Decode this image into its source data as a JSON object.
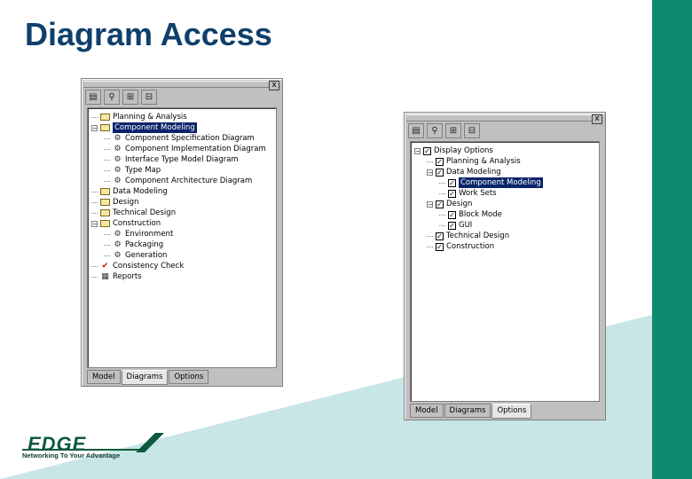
{
  "slide": {
    "title": "Diagram Access"
  },
  "logo": {
    "word": "EDGE",
    "tagline": "Networking To Your Advantage"
  },
  "left_panel": {
    "close": "x",
    "tree": [
      {
        "label": "Planning & Analysis",
        "level": 0
      },
      {
        "label": "Component Modeling",
        "level": 0,
        "selected": true
      },
      {
        "label": "Component Specification Diagram",
        "level": 1
      },
      {
        "label": "Component Implementation Diagram",
        "level": 1
      },
      {
        "label": "Interface Type Model Diagram",
        "level": 1
      },
      {
        "label": "Type Map",
        "level": 1
      },
      {
        "label": "Component Architecture Diagram",
        "level": 1
      },
      {
        "label": "Data Modeling",
        "level": 0
      },
      {
        "label": "Design",
        "level": 0
      },
      {
        "label": "Technical Design",
        "level": 0
      },
      {
        "label": "Construction",
        "level": 0
      },
      {
        "label": "Environment",
        "level": 1
      },
      {
        "label": "Packaging",
        "level": 1
      },
      {
        "label": "Generation",
        "level": 1
      },
      {
        "label": "Consistency Check",
        "level": 0
      },
      {
        "label": "Reports",
        "level": 0
      }
    ],
    "tabs": [
      "Model",
      "Diagrams",
      "Options"
    ],
    "active_tab": "Diagrams"
  },
  "right_panel": {
    "close": "x",
    "tree": [
      {
        "label": "Display Options",
        "level": 0
      },
      {
        "label": "Planning & Analysis",
        "level": 1
      },
      {
        "label": "Data Modeling",
        "level": 1
      },
      {
        "label": "Component Modeling",
        "level": 2,
        "selected": true
      },
      {
        "label": "Work Sets",
        "level": 2
      },
      {
        "label": "Design",
        "level": 1
      },
      {
        "label": "Block Mode",
        "level": 2
      },
      {
        "label": "GUI",
        "level": 2
      },
      {
        "label": "Technical Design",
        "level": 1
      },
      {
        "label": "Construction",
        "level": 1
      }
    ],
    "tabs": [
      "Model",
      "Diagrams",
      "Options"
    ],
    "active_tab": "Options"
  },
  "colors": {
    "accent": "#0f8a6f",
    "title": "#0f3f6b",
    "selection": "#0a246a"
  }
}
